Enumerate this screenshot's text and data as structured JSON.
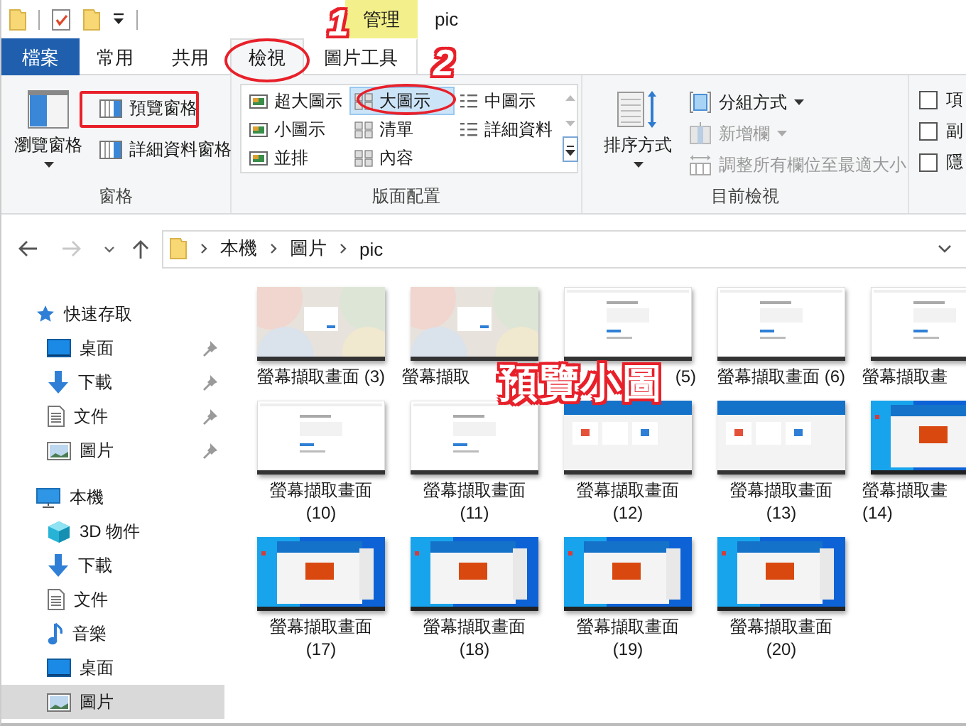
{
  "window": {
    "title": "pic"
  },
  "context_header": "管理",
  "tabs": [
    {
      "label": "檔案",
      "kind": "file",
      "selected": false
    },
    {
      "label": "常用",
      "kind": "normal",
      "selected": false
    },
    {
      "label": "共用",
      "kind": "normal",
      "selected": false
    },
    {
      "label": "檢視",
      "kind": "normal",
      "selected": true
    },
    {
      "label": "圖片工具",
      "kind": "context",
      "selected": false
    }
  ],
  "ribbon": {
    "panes": {
      "label": "窗格",
      "navigation_pane": "瀏覽窗格",
      "preview_pane": "預覽窗格",
      "details_pane": "詳細資料窗格"
    },
    "layout": {
      "label": "版面配置",
      "options": [
        {
          "label": "超大圖示",
          "selected": false
        },
        {
          "label": "大圖示",
          "selected": true
        },
        {
          "label": "中圖示",
          "selected": false
        },
        {
          "label": "小圖示",
          "selected": false
        },
        {
          "label": "清單",
          "selected": false
        },
        {
          "label": "詳細資料",
          "selected": false
        },
        {
          "label": "並排",
          "selected": false
        },
        {
          "label": "內容",
          "selected": false
        }
      ]
    },
    "current_view": {
      "label": "目前檢視",
      "sort_by": "排序方式",
      "commands": [
        {
          "label": "分組方式",
          "disabled": false,
          "dropdown": true
        },
        {
          "label": "新增欄",
          "disabled": true,
          "dropdown": true
        },
        {
          "label": "調整所有欄位至最適大小",
          "disabled": true,
          "dropdown": false
        }
      ]
    },
    "show_hide": {
      "checkboxes": [
        {
          "label": "項",
          "checked": false
        },
        {
          "label": "副",
          "checked": false
        },
        {
          "label": "隱",
          "checked": false
        }
      ]
    }
  },
  "address_bar": {
    "path": [
      "本機",
      "圖片",
      "pic"
    ]
  },
  "sidebar": {
    "items": [
      {
        "label": "快速存取",
        "kind": "star",
        "selected": false,
        "children": [
          {
            "label": "桌面",
            "kind": "desktop",
            "pinned": true,
            "selected": false
          },
          {
            "label": "下載",
            "kind": "download",
            "pinned": true,
            "selected": false
          },
          {
            "label": "文件",
            "kind": "document",
            "pinned": true,
            "selected": false
          },
          {
            "label": "圖片",
            "kind": "pictures",
            "pinned": true,
            "selected": false
          }
        ]
      },
      {
        "label": "本機",
        "kind": "pc",
        "selected": false,
        "children": [
          {
            "label": "3D 物件",
            "kind": "cube",
            "pinned": false,
            "selected": false
          },
          {
            "label": "下載",
            "kind": "download",
            "pinned": false,
            "selected": false
          },
          {
            "label": "文件",
            "kind": "document",
            "pinned": false,
            "selected": false
          },
          {
            "label": "音樂",
            "kind": "music",
            "pinned": false,
            "selected": false
          },
          {
            "label": "桌面",
            "kind": "desktop",
            "pinned": false,
            "selected": false
          },
          {
            "label": "圖片",
            "kind": "pictures",
            "pinned": false,
            "selected": true
          }
        ]
      }
    ]
  },
  "files": [
    {
      "lines": [
        "螢幕擷取畫面 (3)"
      ],
      "kind": "full"
    },
    {
      "lines": [
        "螢幕擷取"
      ],
      "kind": "head"
    },
    {
      "lines": [
        "(5)"
      ],
      "kind": "tail"
    },
    {
      "lines": [
        "螢幕擷取畫面 (6)"
      ],
      "kind": "full"
    },
    {
      "lines": [
        "螢幕擷取畫"
      ],
      "kind": "head"
    },
    {
      "lines": [
        "螢幕擷取畫面",
        "(10)"
      ],
      "kind": "full"
    },
    {
      "lines": [
        "螢幕擷取畫面",
        "(11)"
      ],
      "kind": "full"
    },
    {
      "lines": [
        "螢幕擷取畫面",
        "(12)"
      ],
      "kind": "full"
    },
    {
      "lines": [
        "螢幕擷取畫面",
        "(13)"
      ],
      "kind": "full"
    },
    {
      "lines": [
        "螢幕擷取畫",
        "(14)"
      ],
      "kind": "head"
    },
    {
      "lines": [
        "螢幕擷取畫面",
        "(17)"
      ],
      "kind": "full"
    },
    {
      "lines": [
        "螢幕擷取畫面",
        "(18)"
      ],
      "kind": "full"
    },
    {
      "lines": [
        "螢幕擷取畫面",
        "(19)"
      ],
      "kind": "full"
    },
    {
      "lines": [
        "螢幕擷取畫面",
        "(20)"
      ],
      "kind": "full"
    }
  ],
  "annotations": [
    {
      "text": "1"
    },
    {
      "text": "2"
    },
    {
      "text": "預覽小圖"
    }
  ]
}
